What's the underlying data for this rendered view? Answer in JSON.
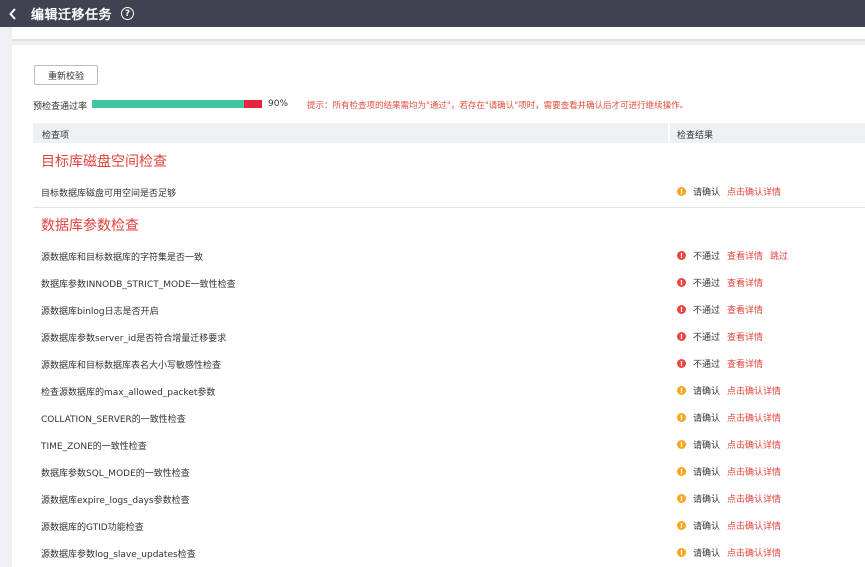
{
  "header": {
    "title": "编辑迁移任务"
  },
  "toolbar": {
    "recheck_label": "重新校验"
  },
  "progress": {
    "label": "预检查通过率",
    "pass_fraction": 0.9,
    "percent_text": "90%",
    "hint": "提示：所有检查项的结果需均为\"通过\"，若存在\"请确认\"项时，需要查看并确认后才可进行继续操作。"
  },
  "table": {
    "col_item": "检查项",
    "col_result": "检查结果"
  },
  "sections": [
    {
      "title": "目标库磁盘空间检查",
      "rows": [
        {
          "label": "目标数据库磁盘可用空间是否足够",
          "status": "请确认",
          "kind": "warn",
          "links": [
            "点击确认详情"
          ]
        }
      ]
    },
    {
      "title": "数据库参数检查",
      "rows": [
        {
          "label": "源数据库和目标数据库的字符集是否一致",
          "status": "不通过",
          "kind": "fail",
          "links": [
            "查看详情",
            "跳过"
          ]
        },
        {
          "label": "数据库参数INNODB_STRICT_MODE一致性检查",
          "status": "不通过",
          "kind": "fail",
          "links": [
            "查看详情"
          ]
        },
        {
          "label": "源数据库binlog日志是否开启",
          "status": "不通过",
          "kind": "fail",
          "links": [
            "查看详情"
          ]
        },
        {
          "label": "源数据库参数server_id是否符合增量迁移要求",
          "status": "不通过",
          "kind": "fail",
          "links": [
            "查看详情"
          ]
        },
        {
          "label": "源数据库和目标数据库表名大小写敏感性检查",
          "status": "不通过",
          "kind": "fail",
          "links": [
            "查看详情"
          ]
        },
        {
          "label": "检查源数据库的max_allowed_packet参数",
          "status": "请确认",
          "kind": "warn",
          "links": [
            "点击确认详情"
          ]
        },
        {
          "label": "COLLATION_SERVER的一致性检查",
          "status": "请确认",
          "kind": "warn",
          "links": [
            "点击确认详情"
          ]
        },
        {
          "label": "TIME_ZONE的一致性检查",
          "status": "请确认",
          "kind": "warn",
          "links": [
            "点击确认详情"
          ]
        },
        {
          "label": "数据库参数SQL_MODE的一致性检查",
          "status": "请确认",
          "kind": "warn",
          "links": [
            "点击确认详情"
          ]
        },
        {
          "label": "源数据库expire_logs_days参数检查",
          "status": "请确认",
          "kind": "warn",
          "links": [
            "点击确认详情"
          ]
        },
        {
          "label": "源数据库的GTID功能检查",
          "status": "请确认",
          "kind": "warn",
          "links": [
            "点击确认详情"
          ]
        },
        {
          "label": "源数据库参数log_slave_updates检查",
          "status": "请确认",
          "kind": "warn",
          "links": [
            "点击确认详情"
          ]
        }
      ]
    }
  ],
  "colors": {
    "topbar": "#3f4350",
    "pass": "#3ec7a0",
    "fail": "#e3263e",
    "warn_icon": "#f5a623",
    "accent_text": "#e0423c"
  },
  "icons": {
    "back": "chevron-left-icon",
    "help": "question-circle-icon",
    "warn": "exclamation-circle-icon",
    "fail": "exclamation-circle-icon"
  }
}
